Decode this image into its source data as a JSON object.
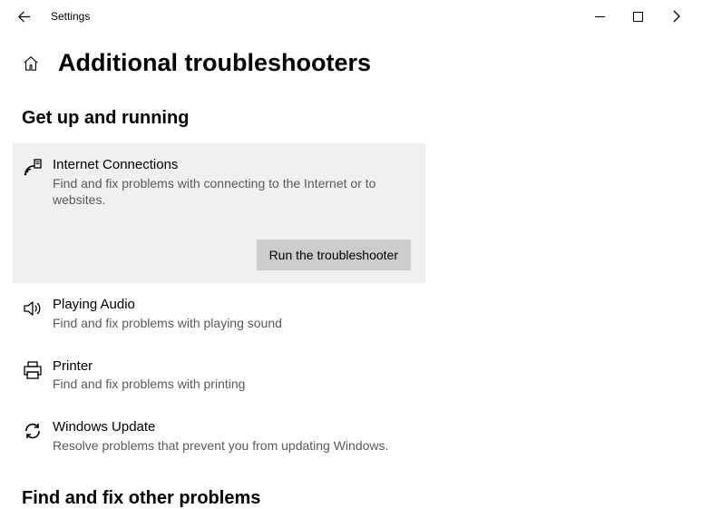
{
  "titlebar": {
    "title": "Settings"
  },
  "header": {
    "title": "Additional troubleshooters"
  },
  "sections": {
    "s1": {
      "heading": "Get up and running"
    },
    "s2": {
      "heading": "Find and fix other problems"
    }
  },
  "items": {
    "internet": {
      "title": "Internet Connections",
      "desc": "Find and fix problems with connecting to the Internet or to websites.",
      "run_label": "Run the troubleshooter"
    },
    "audio": {
      "title": "Playing Audio",
      "desc": "Find and fix problems with playing sound"
    },
    "printer": {
      "title": "Printer",
      "desc": "Find and fix problems with printing"
    },
    "update": {
      "title": "Windows Update",
      "desc": "Resolve problems that prevent you from updating Windows."
    }
  }
}
